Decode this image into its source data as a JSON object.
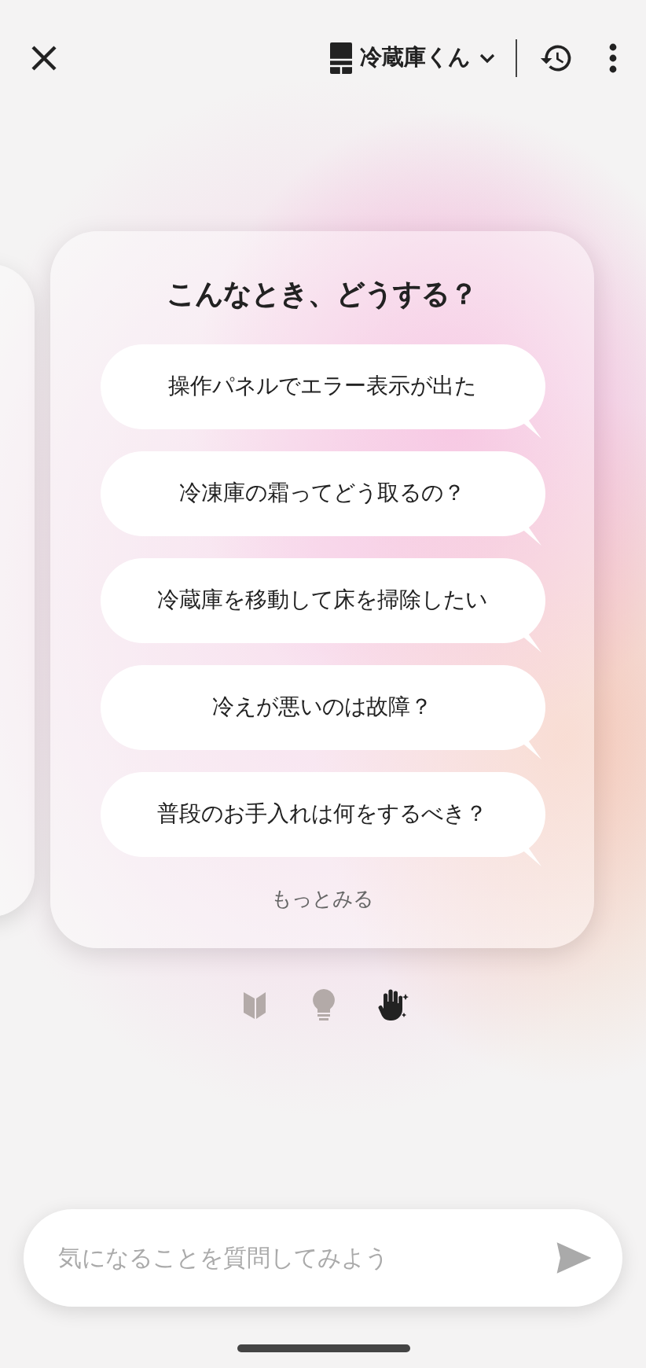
{
  "header": {
    "device_name": "冷蔵庫くん"
  },
  "card": {
    "title": "こんなとき、どうする？",
    "questions": [
      "操作パネルでエラー表示が出た",
      "冷凍庫の霜ってどう取るの？",
      "冷蔵庫を移動して床を掃除したい",
      "冷えが悪いのは故障？",
      "普段のお手入れは何をするべき？"
    ],
    "more_link": "もっとみる"
  },
  "pages": [
    {
      "kind": "beginner",
      "selected": false
    },
    {
      "kind": "tip",
      "selected": false
    },
    {
      "kind": "help",
      "selected": true
    }
  ],
  "input": {
    "placeholder": "気になることを質問してみよう"
  }
}
